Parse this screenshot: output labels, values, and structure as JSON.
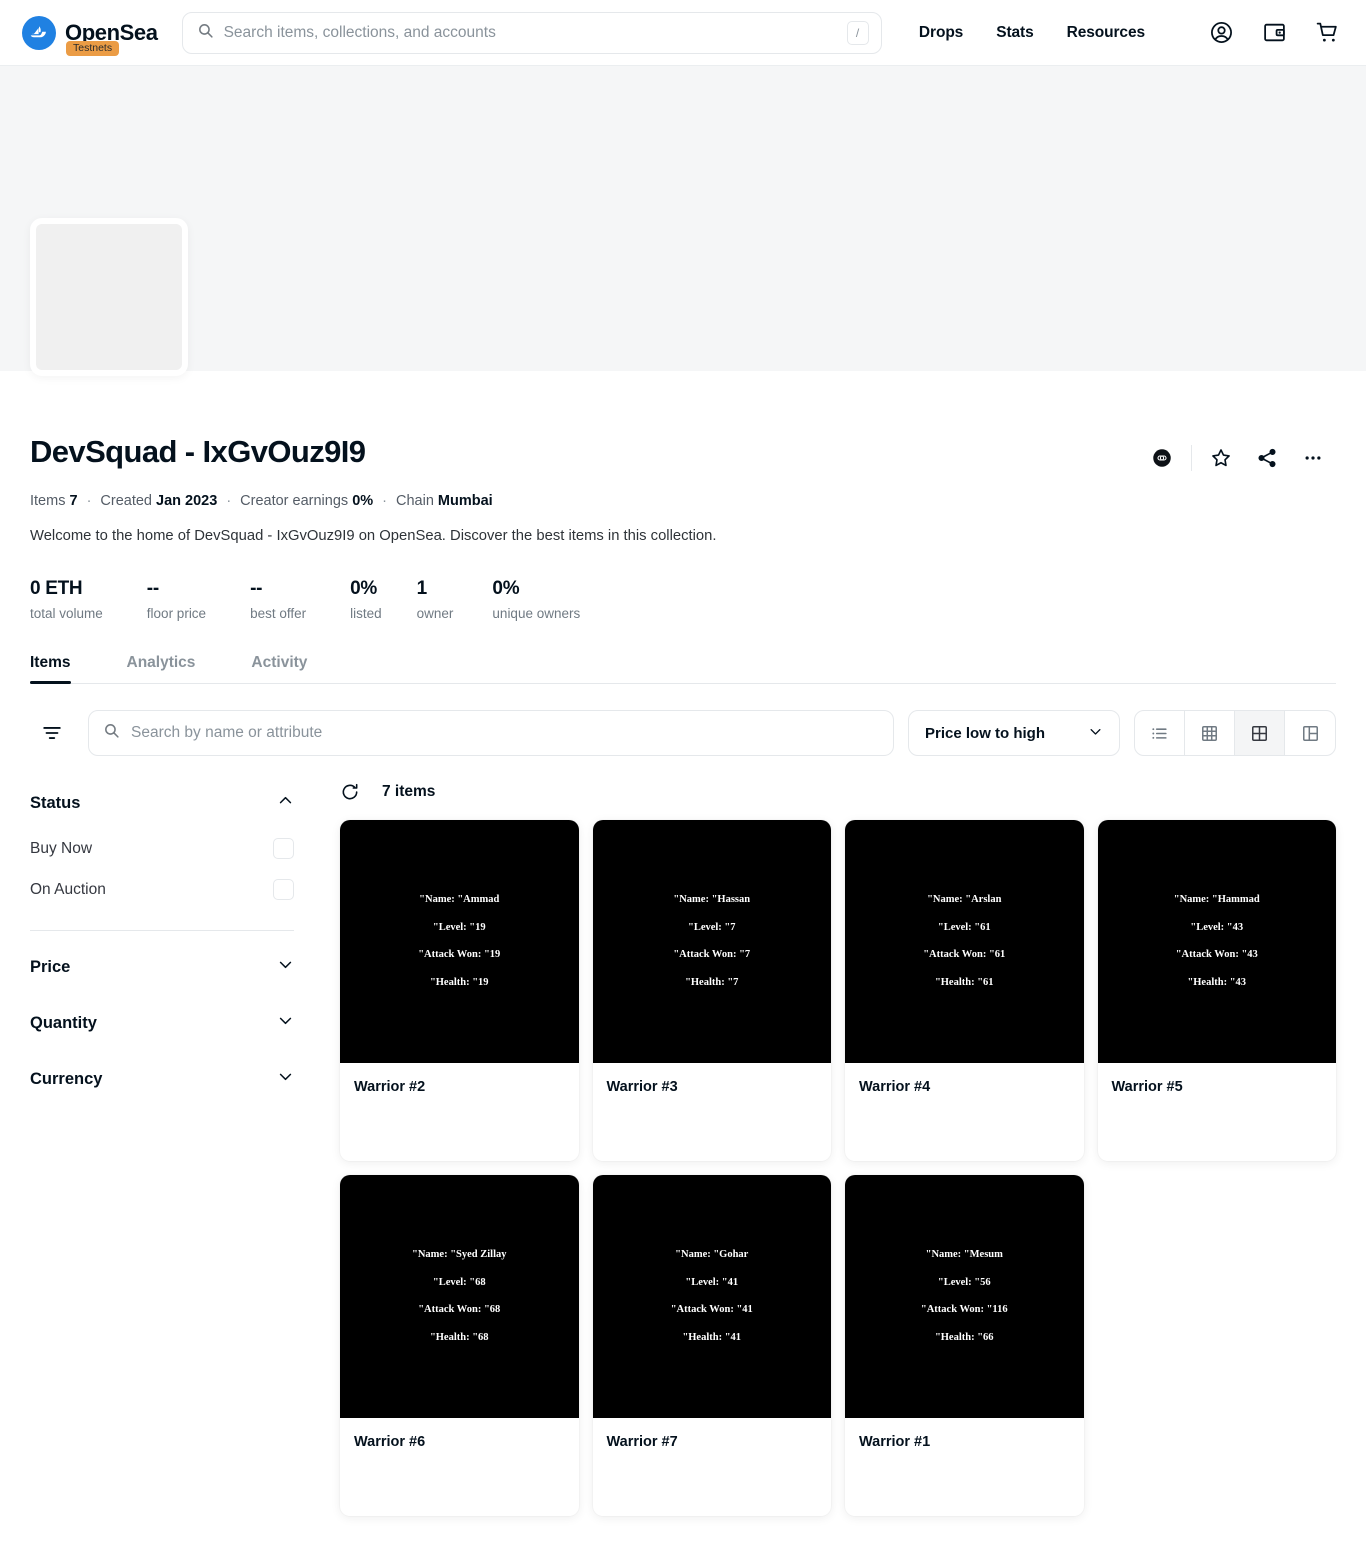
{
  "header": {
    "brand_name": "OpenSea",
    "testnet_badge": "Testnets",
    "search_placeholder": "Search items, collections, and accounts",
    "search_value": "",
    "slash_key": "/",
    "nav_links": [
      {
        "label": "Drops"
      },
      {
        "label": "Stats"
      },
      {
        "label": "Resources"
      }
    ],
    "icons": [
      {
        "name": "account-icon"
      },
      {
        "name": "wallet-icon"
      },
      {
        "name": "cart-icon"
      }
    ]
  },
  "collection": {
    "title": "DevSquad - IxGvOuz9I9",
    "meta": {
      "items_label": "Items",
      "items_value": "7",
      "created_label": "Created",
      "created_value": "Jan 2023",
      "earnings_label": "Creator earnings",
      "earnings_value": "0%",
      "chain_label": "Chain",
      "chain_value": "Mumbai",
      "separator": "·"
    },
    "description": "Welcome to the home of DevSquad - IxGvOuz9I9 on OpenSea. Discover the best items in this collection.",
    "stats": [
      {
        "value": "0 ETH",
        "label": "total volume"
      },
      {
        "value": "--",
        "label": "floor price"
      },
      {
        "value": "--",
        "label": "best offer"
      },
      {
        "value": "0%",
        "label": "listed"
      },
      {
        "value": "1",
        "label": "owner"
      },
      {
        "value": "0%",
        "label": "unique owners"
      }
    ],
    "actions": [
      {
        "name": "chain-badge-icon",
        "label": "chain"
      },
      {
        "name": "star-icon",
        "label": "favorite"
      },
      {
        "name": "share-icon",
        "label": "share"
      },
      {
        "name": "more-icon",
        "label": "more"
      }
    ]
  },
  "tabs": [
    {
      "label": "Items",
      "active": true
    },
    {
      "label": "Analytics",
      "active": false
    },
    {
      "label": "Activity",
      "active": false
    }
  ],
  "toolbar": {
    "search_placeholder": "Search by name or attribute",
    "search_value": "",
    "sort_value": "Price low to high",
    "views": [
      {
        "name": "view-list",
        "active": false
      },
      {
        "name": "view-grid-small",
        "active": false
      },
      {
        "name": "view-grid-large",
        "active": true
      },
      {
        "name": "view-detail",
        "active": false
      }
    ]
  },
  "sidebar": {
    "status": {
      "title": "Status",
      "expanded": true,
      "options": [
        {
          "label": "Buy Now",
          "checked": false
        },
        {
          "label": "On Auction",
          "checked": false
        }
      ]
    },
    "sections": [
      {
        "title": "Price",
        "expanded": false
      },
      {
        "title": "Quantity",
        "expanded": false
      },
      {
        "title": "Currency",
        "expanded": false
      }
    ]
  },
  "items_bar": {
    "count_label": "7 items"
  },
  "items": [
    {
      "title": "Warrior #2",
      "attributes": [
        "\"Name: \"Ammad",
        "\"Level: \"19",
        "\"Attack Won: \"19",
        "\"Health: \"19"
      ]
    },
    {
      "title": "Warrior #3",
      "attributes": [
        "\"Name: \"Hassan",
        "\"Level: \"7",
        "\"Attack Won: \"7",
        "\"Health: \"7"
      ]
    },
    {
      "title": "Warrior #4",
      "attributes": [
        "\"Name: \"Arslan",
        "\"Level: \"61",
        "\"Attack Won: \"61",
        "\"Health: \"61"
      ]
    },
    {
      "title": "Warrior #5",
      "attributes": [
        "\"Name: \"Hammad",
        "\"Level: \"43",
        "\"Attack Won: \"43",
        "\"Health: \"43"
      ]
    },
    {
      "title": "Warrior #6",
      "attributes": [
        "\"Name: \"Syed Zillay",
        "\"Level: \"68",
        "\"Attack Won: \"68",
        "\"Health: \"68"
      ]
    },
    {
      "title": "Warrior #7",
      "attributes": [
        "\"Name: \"Gohar",
        "\"Level: \"41",
        "\"Attack Won: \"41",
        "\"Health: \"41"
      ]
    },
    {
      "title": "Warrior #1",
      "attributes": [
        "\"Name: \"Mesum",
        "\"Level: \"56",
        "\"Attack Won: \"116",
        "\"Health: \"66"
      ]
    }
  ],
  "colors": {
    "brand_blue": "#2081e2",
    "testnet_orange": "#eb9c45",
    "text_primary": "#04111d",
    "text_muted": "#8a939b",
    "card_media_bg": "#000000",
    "banner_bg": "#f5f6f7"
  }
}
